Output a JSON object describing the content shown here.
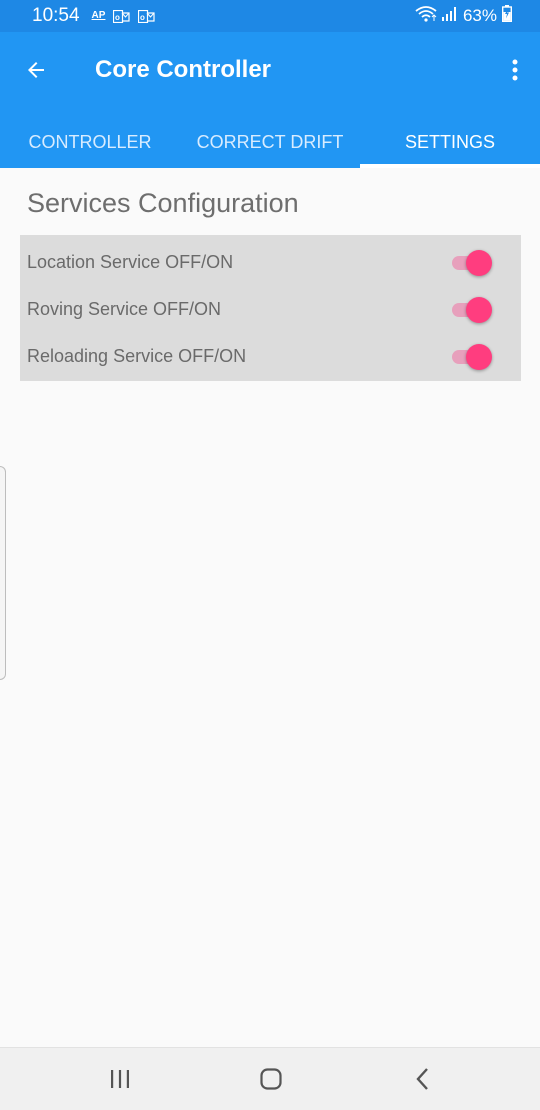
{
  "status_bar": {
    "time": "10:54",
    "notifications": [
      {
        "icon": "ap-notification-icon",
        "text": "AP"
      },
      {
        "icon": "outlook-icon"
      },
      {
        "icon": "outlook-icon"
      }
    ],
    "battery_percent": "63%",
    "icons": [
      "wifi-icon",
      "signal-icon",
      "battery-charging-icon"
    ]
  },
  "app_bar": {
    "title": "Core Controller",
    "back_icon": "arrow-back-icon",
    "menu_icon": "more-vert-icon",
    "color": "#2196f3"
  },
  "tabs": [
    {
      "label": "CONTROLLER",
      "active": false
    },
    {
      "label": "CORRECT DRIFT",
      "active": false
    },
    {
      "label": "SETTINGS",
      "active": true
    }
  ],
  "content": {
    "section_title": "Services Configuration",
    "settings": [
      {
        "label": "Location Service OFF/ON",
        "enabled": true
      },
      {
        "label": "Roving Service OFF/ON",
        "enabled": true
      },
      {
        "label": "Reloading Service OFF/ON",
        "enabled": true
      }
    ],
    "switch_color": "#ff3d7f"
  },
  "nav_bar": {
    "buttons": [
      "recents-icon",
      "home-icon",
      "back-icon"
    ]
  }
}
